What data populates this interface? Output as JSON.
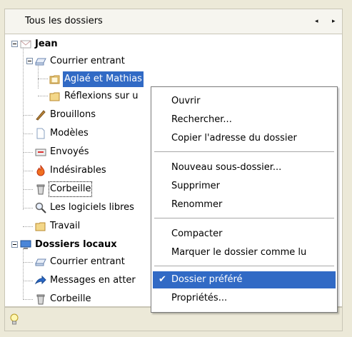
{
  "header": {
    "title": "Tous les dossiers",
    "nav_left": "◂",
    "nav_right": "▸"
  },
  "tree": {
    "account1": "Jean",
    "inbox": "Courrier entrant",
    "sub1": "Aglaé et Mathias",
    "sub2": "Réflexions sur u",
    "drafts": "Brouillons",
    "templates": "Modèles",
    "sent": "Envoyés",
    "junk": "Indésirables",
    "trash": "Corbeille",
    "free": "Les logiciels libres",
    "work": "Travail",
    "account2": "Dossiers locaux",
    "local_inbox": "Courrier entrant",
    "outbox": "Messages en atter",
    "local_trash": "Corbeille"
  },
  "menu": {
    "open": "Ouvrir",
    "search": "Rechercher...",
    "copy": "Copier l'adresse du dossier",
    "new": "Nouveau sous-dossier...",
    "delete": "Supprimer",
    "rename": "Renommer",
    "compact": "Compacter",
    "markread": "Marquer le dossier comme lu",
    "favorite": "Dossier préféré",
    "properties": "Propriétés..."
  },
  "colors": {
    "selection": "#316ac5",
    "chrome": "#ece9d8"
  }
}
